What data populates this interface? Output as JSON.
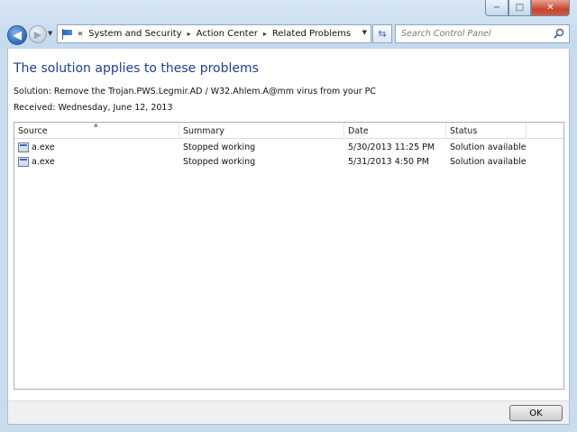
{
  "window": {
    "buttons": {
      "minimize": "−",
      "maximize": "□",
      "close": "✕"
    }
  },
  "nav": {
    "back": "◀",
    "forward": "▶",
    "history_drop": "▼"
  },
  "address": {
    "breadcrumb": [
      "System and Security",
      "Action Center",
      "Related Problems"
    ],
    "overflow": "«",
    "separator": "▸",
    "dropdown": "▼"
  },
  "refresh": {
    "glyph": "⇆"
  },
  "search": {
    "placeholder": "Search Control Panel"
  },
  "content": {
    "heading": "The solution applies to these problems",
    "solution": "Solution: Remove the Trojan.PWS.Legmir.AD / W32.Ahlem.A@mm virus from your PC",
    "received": "Received: Wednesday, June 12, 2013"
  },
  "table": {
    "columns": [
      "Source",
      "Summary",
      "Date",
      "Status"
    ],
    "sort_glyph": "▲",
    "rows": [
      {
        "source": "a.exe",
        "summary": "Stopped working",
        "date": "5/30/2013 11:25 PM",
        "status": "Solution available"
      },
      {
        "source": "a.exe",
        "summary": "Stopped working",
        "date": "5/31/2013 4:50 PM",
        "status": "Solution available"
      }
    ]
  },
  "footer": {
    "ok_label": "OK"
  },
  "colors": {
    "heading": "#1e3f8d",
    "frame": "#c9dcee",
    "close": "#c7452f"
  }
}
